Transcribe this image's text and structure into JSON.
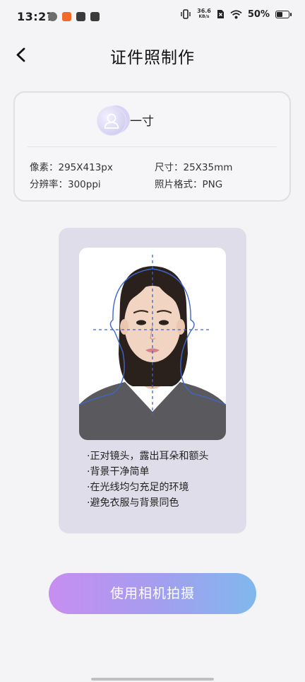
{
  "status_bar": {
    "time": "13:27",
    "net_speed_value": "36.6",
    "net_speed_unit": "KB/s",
    "battery_pct": "50%"
  },
  "nav": {
    "title": "证件照制作",
    "back_icon": "chevron-left-icon"
  },
  "spec": {
    "name": "一寸",
    "pixels": "像素：295X413px",
    "size": "尺寸：25X35mm",
    "resolution": "分辨率：300ppi",
    "format": "照片格式：PNG"
  },
  "guide": {
    "tips": [
      "·正对镜头，露出耳朵和额头",
      "·背景干净简单",
      "·在光线均匀充足的环境",
      "·避免衣服与背景同色"
    ]
  },
  "action": {
    "camera_label": "使用相机拍摄"
  },
  "colors": {
    "background": "#f4f4f6",
    "guide_card": "#dedde9",
    "button_gradient_start": "#c78ef0",
    "button_gradient_end": "#80b8ec",
    "guide_line": "#3d67c9"
  }
}
